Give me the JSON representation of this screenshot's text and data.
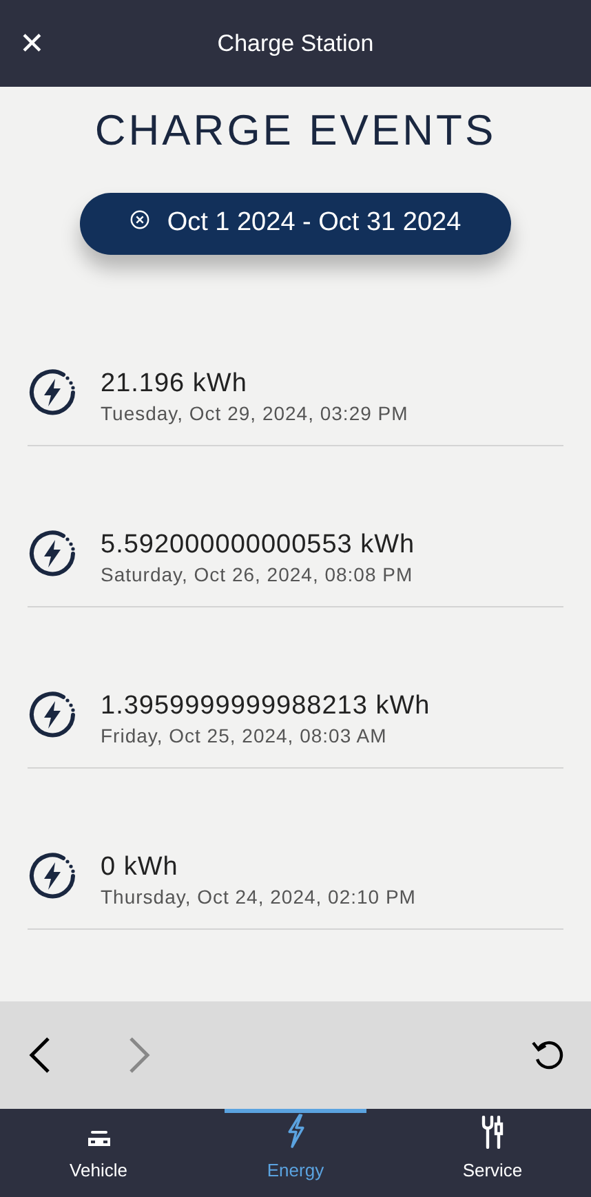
{
  "header": {
    "close": "✕",
    "title": "Charge Station"
  },
  "heading": "CHARGE EVENTS",
  "date_filter": {
    "label": "Oct 1 2024 - Oct 31 2024"
  },
  "events": [
    {
      "energy": "21.196 kWh",
      "date": "Tuesday, Oct 29, 2024, 03:29 PM"
    },
    {
      "energy": "5.592000000000553 kWh",
      "date": "Saturday, Oct 26, 2024, 08:08 PM"
    },
    {
      "energy": "1.3959999999988213 kWh",
      "date": "Friday, Oct 25, 2024, 08:03 AM"
    },
    {
      "energy": "0 kWh",
      "date": "Thursday, Oct 24, 2024, 02:10 PM"
    }
  ],
  "browser_bar": {
    "back_disabled": false,
    "forward_disabled": true
  },
  "tabs": [
    {
      "kind": "vehicle",
      "label": "Vehicle",
      "selected": false
    },
    {
      "kind": "energy",
      "label": "Energy",
      "selected": true
    },
    {
      "kind": "service",
      "label": "Service",
      "selected": false
    }
  ]
}
